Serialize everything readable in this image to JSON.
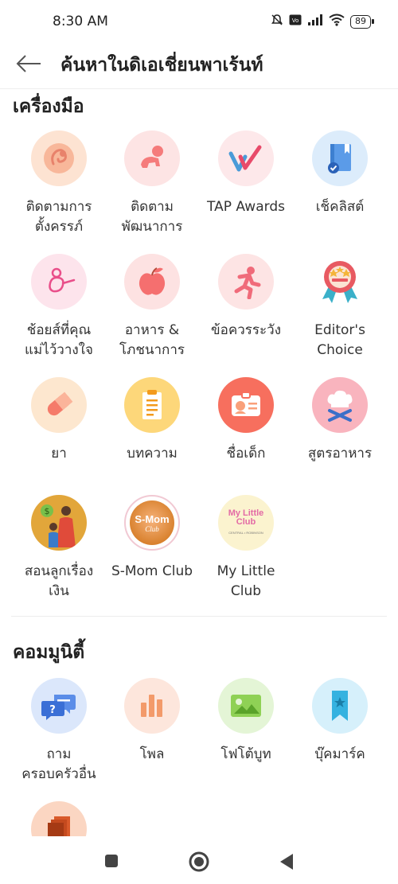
{
  "status": {
    "time": "8:30 AM",
    "battery": "89"
  },
  "header": {
    "title": "ค้นหาในดิเอเชี่ยนพาเร้นท์"
  },
  "tools": {
    "title": "เครื่องมือ",
    "items": [
      {
        "line1": "ติดตามการ",
        "line2": "ตั้งครรภ์",
        "icon": "fetus-icon",
        "bg": "#fde3d2"
      },
      {
        "line1": "ติดตาม",
        "line2": "พัฒนาการ",
        "icon": "crawling-baby-icon",
        "bg": "#fde4e4"
      },
      {
        "line1": "TAP Awards",
        "line2": "",
        "icon": "checkmark-award-icon",
        "bg": "#fde8ea"
      },
      {
        "line1": "เช็คลิสต์",
        "line2": "",
        "icon": "checklist-book-icon",
        "bg": "#dcecfb"
      },
      {
        "line1": "ช้อยส์ที่คุณ",
        "line2": "แม่ไว้วางใจ",
        "icon": "mother-baby-icon",
        "bg": "#fde4ec"
      },
      {
        "line1": "อาหาร &",
        "line2": "โภชนาการ",
        "icon": "apple-icon",
        "bg": "#fde2e2"
      },
      {
        "line1": "ข้อควรระวัง",
        "line2": "",
        "icon": "running-person-icon",
        "bg": "#fde4e4"
      },
      {
        "line1": "Editor's",
        "line2": "Choice",
        "icon": "ribbon-badge-icon",
        "bg": "#ffffff"
      },
      {
        "line1": "ยา",
        "line2": "",
        "icon": "pill-icon",
        "bg": "#fde7cf"
      },
      {
        "line1": "บทความ",
        "line2": "",
        "icon": "clipboard-icon",
        "bg": "#fdd77a"
      },
      {
        "line1": "ชื่อเด็ก",
        "line2": "",
        "icon": "id-card-icon",
        "bg": "#f76f5e"
      },
      {
        "line1": "สูตรอาหาร",
        "line2": "",
        "icon": "chef-hat-icon",
        "bg": "#f9b4be"
      },
      {
        "line1": "สอนลูกเรื่อง",
        "line2": "เงิน",
        "icon": "family-money-icon",
        "bg": "#e2a63a"
      },
      {
        "line1": "S-Mom Club",
        "line2": "",
        "icon": "smom-club-logo",
        "bg": "#ffffff",
        "logo_text": "S-Mom",
        "logo_sub": "Club"
      },
      {
        "line1": "My Little",
        "line2": "Club",
        "icon": "my-little-club-logo",
        "bg": "#fbf3cf",
        "logo_text": "My Little Club",
        "logo_sub": "CENTRAL • ROBINSON"
      }
    ]
  },
  "community": {
    "title": "คอมมูนิตี้",
    "items": [
      {
        "line1": "ถาม",
        "line2": "ครอบครัวอื่น",
        "icon": "chat-question-icon",
        "bg": "#dbe7fb"
      },
      {
        "line1": "โพล",
        "line2": "",
        "icon": "poll-bars-icon",
        "bg": "#fde6dc"
      },
      {
        "line1": "โฟโต้บูท",
        "line2": "",
        "icon": "photo-icon",
        "bg": "#e4f5d6"
      },
      {
        "line1": "บุ๊คมาร์ค",
        "line2": "",
        "icon": "bookmark-icon",
        "bg": "#d6f0fb"
      },
      {
        "line1": "",
        "line2": "",
        "icon": "album-stack-icon",
        "bg": "#fbd6c2"
      }
    ]
  },
  "nav": {
    "recents": "recents-button",
    "home": "home-button",
    "back": "back-button"
  }
}
